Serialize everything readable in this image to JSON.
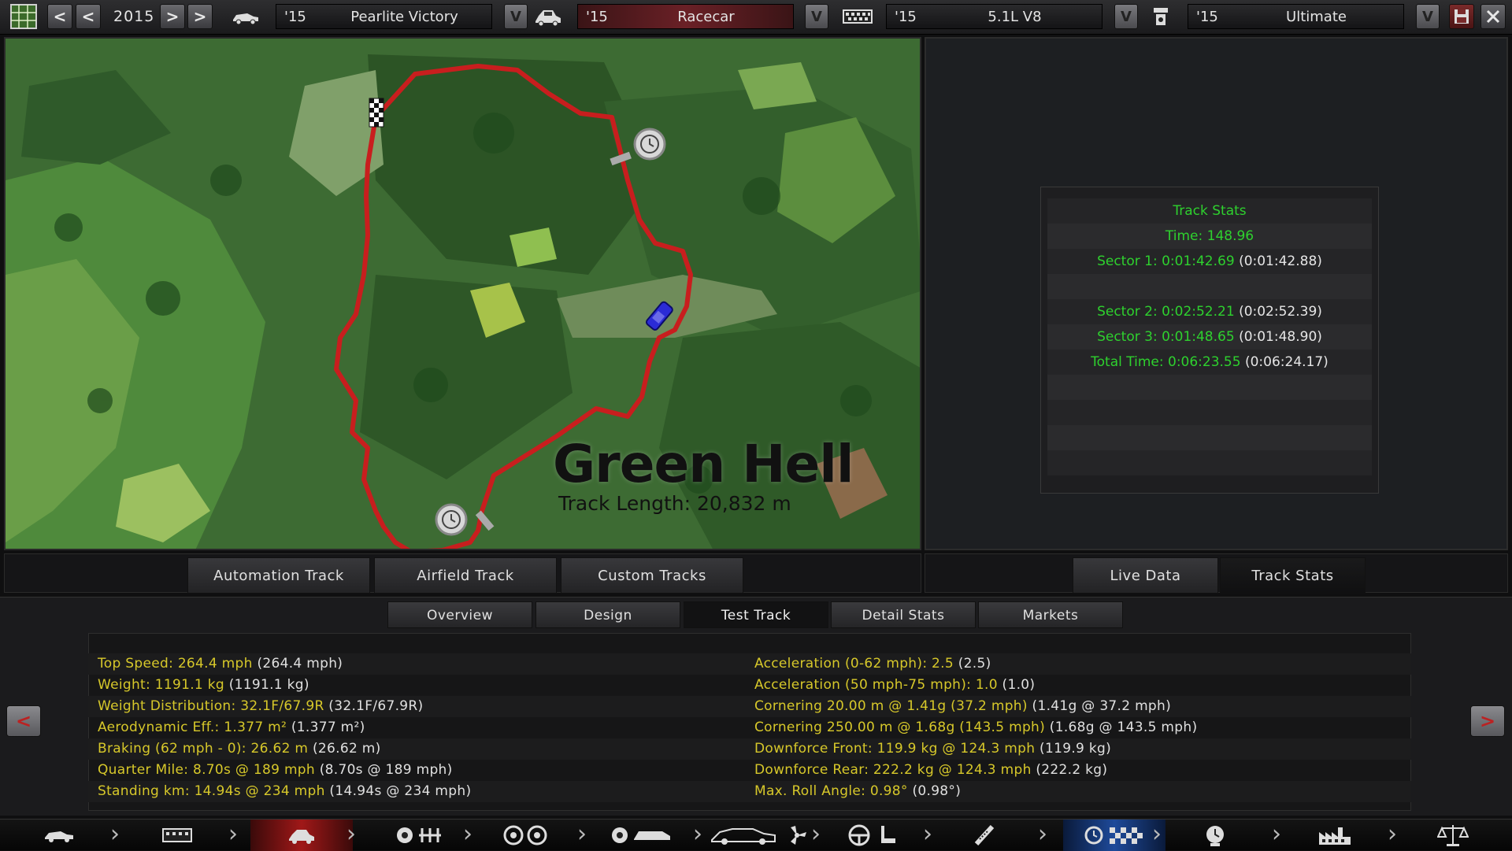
{
  "topbar": {
    "year": "2015",
    "model": {
      "year": "'15",
      "name": "Pearlite Victory"
    },
    "trim": {
      "year": "'15",
      "name": "Racecar"
    },
    "engine": {
      "year": "'15",
      "name": "5.1L V8"
    },
    "variant": {
      "year": "'15",
      "name": "Ultimate"
    },
    "dropdown_glyph": "V"
  },
  "map": {
    "track_name": "Green Hell",
    "track_length": "Track Length: 20,832 m"
  },
  "track_tabs": [
    "Automation Track",
    "Airfield Track",
    "Custom Tracks"
  ],
  "right_tabs": [
    "Live Data",
    "Track Stats"
  ],
  "track_stats": {
    "title": "Track Stats",
    "time": "Time: 148.96",
    "sector1": {
      "label": "Sector 1: 0:01:42.69",
      "ref": "(0:01:42.88)"
    },
    "sector2": {
      "label": "Sector 2: 0:02:52.21",
      "ref": "(0:02:52.39)"
    },
    "sector3": {
      "label": "Sector 3: 0:01:48.65",
      "ref": "(0:01:48.90)"
    },
    "total": {
      "label": "Total Time: 0:06:23.55",
      "ref": "(0:06:24.17)"
    }
  },
  "main_tabs": [
    "Overview",
    "Design",
    "Test Track",
    "Detail Stats",
    "Markets"
  ],
  "stats_left": [
    {
      "k": "Top Speed: 264.4 mph",
      "v": "(264.4 mph)"
    },
    {
      "k": "Weight: 1191.1 kg",
      "v": "(1191.1 kg)"
    },
    {
      "k": "Weight Distribution: 32.1F/67.9R",
      "v": "(32.1F/67.9R)"
    },
    {
      "k": "Aerodynamic Eff.: 1.377 m²",
      "v": "(1.377 m²)"
    },
    {
      "k": "Braking (62 mph - 0): 26.62 m",
      "v": "(26.62 m)"
    },
    {
      "k": "Quarter Mile: 8.70s @ 189 mph",
      "v": "(8.70s @ 189 mph)"
    },
    {
      "k": "Standing km: 14.94s @ 234 mph",
      "v": "(14.94s @ 234 mph)"
    }
  ],
  "stats_right": [
    {
      "k": "Acceleration (0-62 mph): 2.5",
      "v": "(2.5)"
    },
    {
      "k": "Acceleration (50 mph-75 mph): 1.0",
      "v": "(1.0)"
    },
    {
      "k": "Cornering 20.00 m @ 1.41g (37.2 mph)",
      "v": "(1.41g @ 37.2 mph)"
    },
    {
      "k": "Cornering 250.00 m @ 1.68g (143.5 mph)",
      "v": "(1.68g @ 143.5 mph)"
    },
    {
      "k": "Downforce Front: 119.9 kg @ 124.3 mph",
      "v": "(119.9 kg)"
    },
    {
      "k": "Downforce Rear: 222.2 kg @ 124.3 mph",
      "v": "(222.2 kg)"
    },
    {
      "k": "Max. Roll Angle: 0.98°",
      "v": "(0.98°)"
    }
  ],
  "colors": {
    "accent_green": "#2ed12e",
    "stat_yellow": "#d7c82a",
    "track_red": "#c81e1e"
  }
}
